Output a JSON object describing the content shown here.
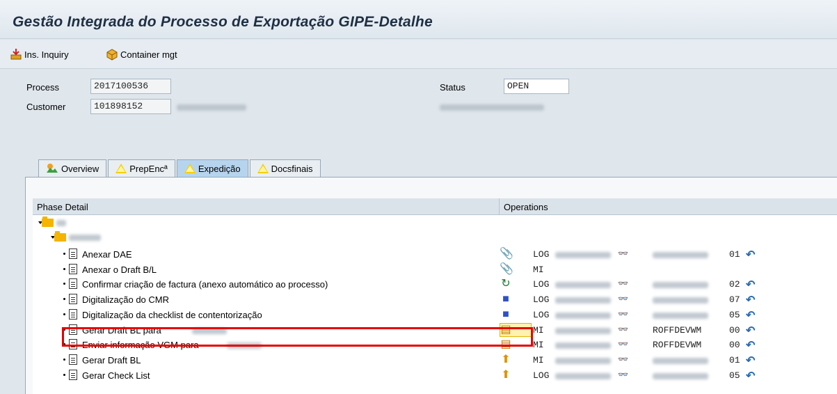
{
  "window": {
    "title": "Gestão Integrada do Processo de Exportação GIPE-Detalhe"
  },
  "toolbar": {
    "ins_inquiry": "Ins. Inquiry",
    "container_mgt": "Container mgt"
  },
  "header": {
    "process_label": "Process",
    "process_value": "2017100536",
    "customer_label": "Customer",
    "customer_value": "101898152",
    "status_label": "Status",
    "status_value": "OPEN"
  },
  "tabs": [
    {
      "label": "Overview",
      "icon": "overview-icon"
    },
    {
      "label": "PrepEncª",
      "icon": "warning-icon"
    },
    {
      "label": "Expedição",
      "icon": "warning-icon"
    },
    {
      "label": "Docsfinais",
      "icon": "warning-icon"
    }
  ],
  "tree": {
    "col_phase": "Phase Detail",
    "col_operations": "Operations",
    "rows": [
      {
        "label": "Anexar DAE",
        "icon": "attach-icon",
        "type": "LOG",
        "user": "",
        "num": "01"
      },
      {
        "label": "Anexar o Draft B/L",
        "icon": "attach-icon",
        "type": "MI",
        "user": "",
        "num": ""
      },
      {
        "label": "Confirmar criação de factura (anexo automático ao processo)",
        "icon": "confirm-icon",
        "type": "LOG",
        "user": "",
        "num": "02"
      },
      {
        "label": "Digitalização do CMR",
        "icon": "scan-icon",
        "type": "LOG",
        "user": "",
        "num": "07"
      },
      {
        "label": "Digitalização da checklist de contentorização",
        "icon": "scan-icon",
        "type": "LOG",
        "user": "",
        "num": "05"
      },
      {
        "label": "Gerar Draft BL para",
        "icon": "generate-doc-icon",
        "type": "MI",
        "user": "ROFFDEVWM",
        "num": "00"
      },
      {
        "label": "Enviar informação VGM para",
        "icon": "generate-doc-icon",
        "type": "MI",
        "user": "ROFFDEVWM",
        "num": "00"
      },
      {
        "label": "Gerar Draft BL",
        "icon": "generate-icon",
        "type": "MI",
        "user": "",
        "num": "01"
      },
      {
        "label": "Gerar Check List",
        "icon": "generate-icon",
        "type": "LOG",
        "user": "",
        "num": "05"
      }
    ]
  }
}
